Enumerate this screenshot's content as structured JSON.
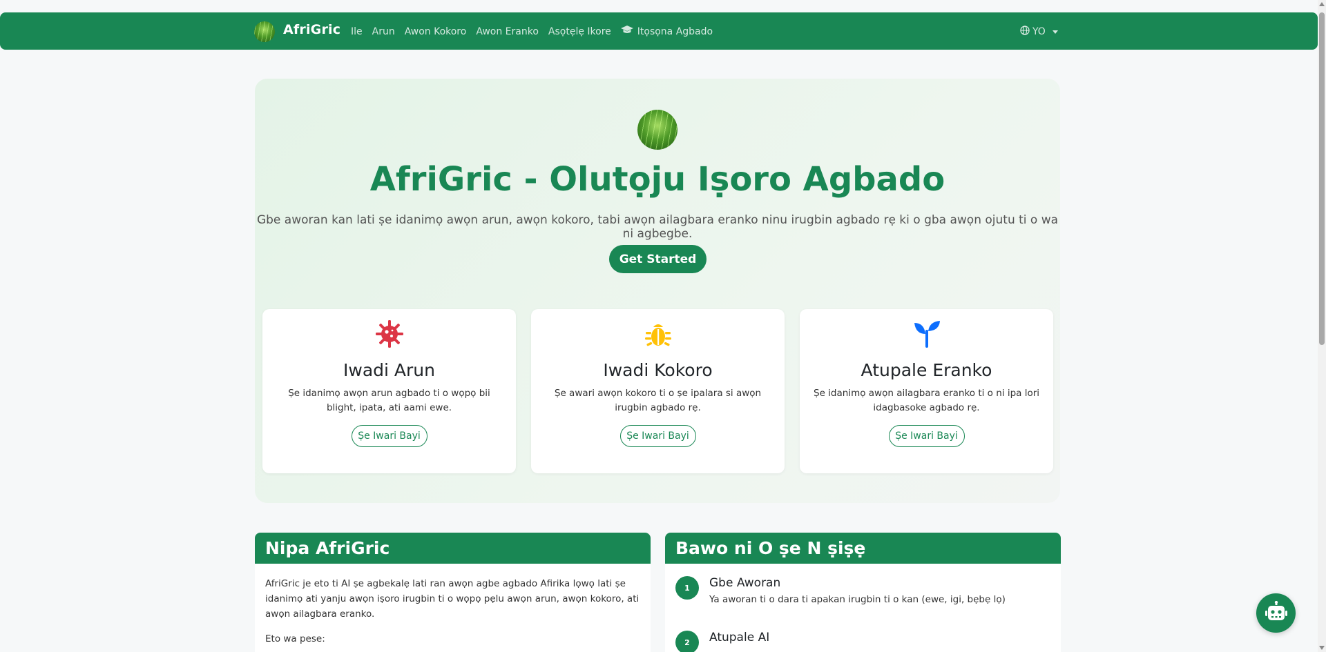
{
  "nav": {
    "brand": "AfriGric",
    "items": [
      "Ile",
      "Arun",
      "Awon Kokoro",
      "Awon Eranko",
      "Asọtẹlẹ Ikore",
      "Itọsọna Agbado"
    ],
    "lang": "YO"
  },
  "hero": {
    "title": "AfriGric - Olutọju Iṣoro Agbado",
    "subtitle": "Gbe aworan kan lati ṣe idanimọ awọn arun, awọn kokoro, tabi awọn ailagbara eranko ninu irugbin agbado rẹ ki o gba awọn ojutu ti o wa ni agbegbe.",
    "cta": "Get Started"
  },
  "cards": [
    {
      "title": "Iwadi Arun",
      "desc": "Ṣe idanimọ awọn arun agbado ti o wọpọ bii blight, ipata, ati aami ewe.",
      "btn": "Ṣe Iwari Bayi",
      "icon": "virus-icon",
      "color": "#dc3545"
    },
    {
      "title": "Iwadi Kokoro",
      "desc": "Ṣe awari awọn kokoro ti o ṣe ipalara si awọn irugbin agbado rẹ.",
      "btn": "Ṣe Iwari Bayi",
      "icon": "bug-icon",
      "color": "#ffc107"
    },
    {
      "title": "Atupale Eranko",
      "desc": "Ṣe idanimọ awọn ailagbara eranko ti o ni ipa lori idagbasoke agbado rẹ.",
      "btn": "Ṣe Iwari Bayi",
      "icon": "sprout-icon",
      "color": "#0d6efd"
    }
  ],
  "about": {
    "title": "Nipa AfriGric",
    "body": "AfriGric je eto ti AI ṣe agbekalẹ lati ran awọn agbe agbado Afirika lọwọ lati ṣe idanimọ ati yanju awọn iṣoro irugbin ti o wọpọ pẹlu awọn arun, awọn kokoro, ati awọn ailagbara eranko.",
    "offers": "Eto wa pese:"
  },
  "how": {
    "title": "Bawo ni O ṣe N ṣiṣẹ",
    "steps": [
      {
        "num": "1",
        "title": "Gbe Aworan",
        "desc": "Ya aworan ti o dara ti apakan irugbin ti o kan (ewe, igi, bẹbẹ lọ)"
      },
      {
        "num": "2",
        "title": "Atupale AI",
        "desc": ""
      }
    ]
  },
  "colors": {
    "primary": "#198754"
  }
}
